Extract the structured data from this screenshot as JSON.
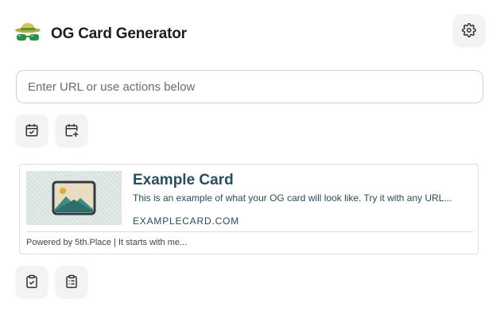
{
  "header": {
    "title": "OG Card Generator",
    "logo_icon": "spy-hat-glasses-icon",
    "settings_icon": "gear-icon"
  },
  "url_input": {
    "placeholder": "Enter URL or use actions below",
    "value": ""
  },
  "actions_top": [
    {
      "icon": "calendar-check-icon"
    },
    {
      "icon": "calendar-plus-icon"
    }
  ],
  "card": {
    "title": "Example Card",
    "description": "This is an example of what your OG card will look like. Try it with any URL...",
    "domain": "EXAMPLECARD.COM",
    "footer": "Powered by 5th.Place | It starts with me...",
    "image_icon": "image-placeholder-icon"
  },
  "actions_bottom": [
    {
      "icon": "clipboard-check-icon"
    },
    {
      "icon": "clipboard-list-icon"
    }
  ],
  "colors": {
    "card_title": "#2a4d5c",
    "button_bg": "#f3f3f3",
    "border": "#cfcfcf"
  }
}
